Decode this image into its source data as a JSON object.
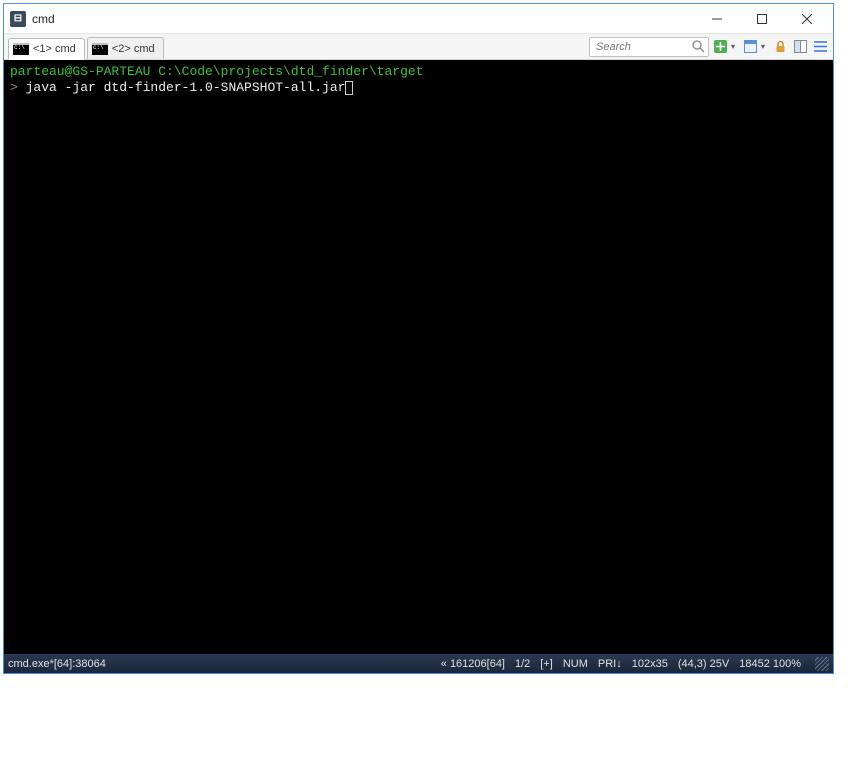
{
  "window": {
    "title": "cmd",
    "app_icon_text": "⊟"
  },
  "tabs": [
    {
      "label": "<1> cmd",
      "active": true
    },
    {
      "label": "<2> cmd",
      "active": false
    }
  ],
  "search": {
    "placeholder": "Search"
  },
  "terminal": {
    "prompt_user": "parteau@GS-PARTEAU ",
    "prompt_path": "C:\\Code\\projects\\dtd_finder\\target",
    "prompt_symbol": "> ",
    "command": "java -jar dtd-finder-1.0-SNAPSHOT-all.jar"
  },
  "statusbar": {
    "process": "cmd.exe*[64]:38064",
    "chars": "« 161206[64]",
    "page": "1/2",
    "modified": "[+]",
    "num": "NUM",
    "pri": "PRI↓",
    "size": "102x35",
    "cursor": "(44,3) 25V",
    "scroll": "18452 100%"
  }
}
